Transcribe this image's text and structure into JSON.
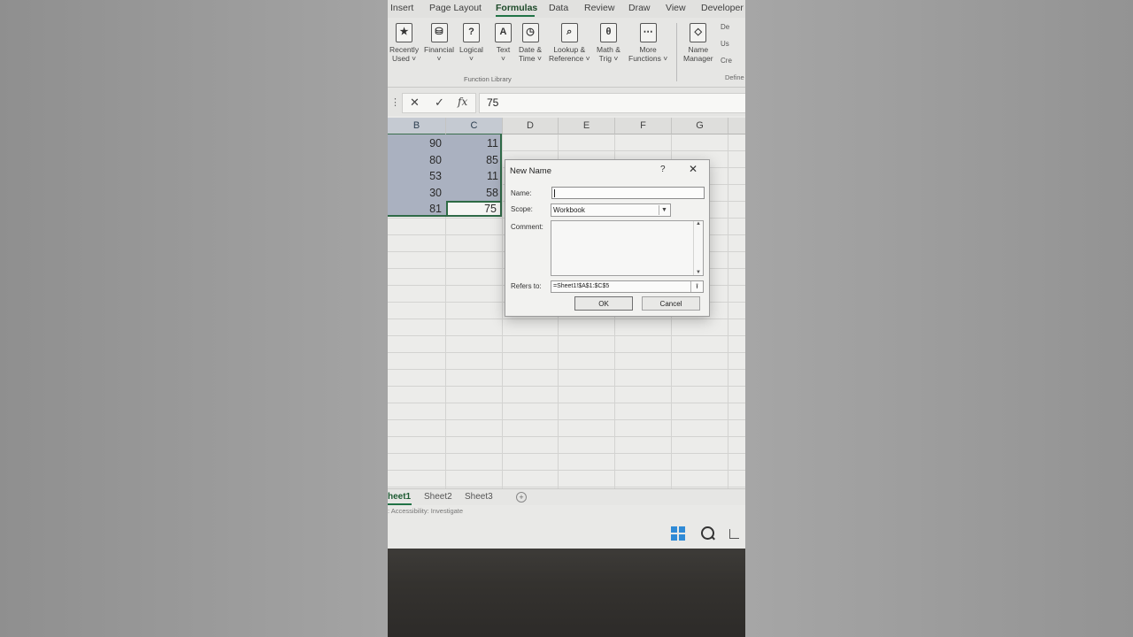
{
  "ribbon": {
    "tabs": [
      "Insert",
      "Page Layout",
      "Formulas",
      "Data",
      "Review",
      "Draw",
      "View",
      "Developer"
    ],
    "active_tab": "Formulas",
    "buttons": [
      {
        "line1": "Recently",
        "line2": "Used ˅",
        "icon": "★"
      },
      {
        "line1": "Financial",
        "line2": "˅",
        "icon": "⛁"
      },
      {
        "line1": "Logical",
        "line2": "˅",
        "icon": "?"
      },
      {
        "line1": "Text",
        "line2": "˅",
        "icon": "A"
      },
      {
        "line1": "Date &",
        "line2": "Time ˅",
        "icon": "◷"
      },
      {
        "line1": "Lookup &",
        "line2": "Reference ˅",
        "icon": "⌕"
      },
      {
        "line1": "Math &",
        "line2": "Trig ˅",
        "icon": "θ"
      },
      {
        "line1": "More",
        "line2": "Functions ˅",
        "icon": "⋯"
      },
      {
        "line1": "Name",
        "line2": "Manager",
        "icon": "◇"
      }
    ],
    "group_label": "Function Library",
    "group_label_right": "Define",
    "right_items": [
      "De",
      "Us",
      "Cre"
    ]
  },
  "formula_bar": {
    "value": "75",
    "cancel": "✕",
    "enter": "✓",
    "fx": "fx"
  },
  "columns": [
    "B",
    "C",
    "D",
    "E",
    "F",
    "G"
  ],
  "rows": [
    {
      "b": "90",
      "c": "11"
    },
    {
      "b": "80",
      "c": "85"
    },
    {
      "b": "53",
      "c": "11"
    },
    {
      "b": "30",
      "c": "58"
    },
    {
      "b": "81",
      "c": "75"
    }
  ],
  "dialog": {
    "title": "New Name",
    "help": "?",
    "close": "✕",
    "name_label": "Name:",
    "name_value": "",
    "scope_label": "Scope:",
    "scope_value": "Workbook",
    "comment_label": "Comment:",
    "refers_label": "Refers to:",
    "refers_value": "=Sheet1!$A$1:$C$5",
    "ok": "OK",
    "cancel": "Cancel"
  },
  "sheets": [
    "heet1",
    "Sheet2",
    "Sheet3"
  ],
  "add_sheet": "+",
  "status_text": ": Accessibility: Investigate"
}
